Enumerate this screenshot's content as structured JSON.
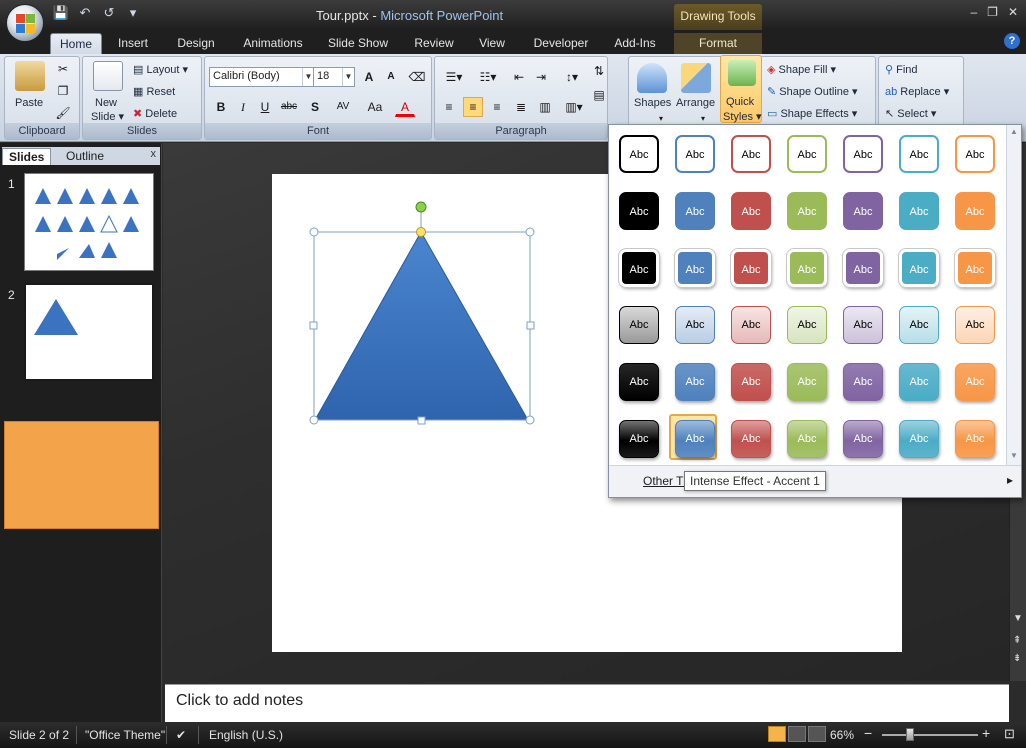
{
  "window": {
    "title_file": "Tour.pptx",
    "title_sep": " - ",
    "title_app": "Microsoft PowerPoint",
    "context_tab_group": "Drawing Tools",
    "controls": [
      "–",
      "❐",
      "✕"
    ],
    "help": "?"
  },
  "quick_access": {
    "save": "💾",
    "undo": "↶",
    "redo": "↺",
    "more": "▾"
  },
  "tabs": [
    "Home",
    "Insert",
    "Design",
    "Animations",
    "Slide Show",
    "Review",
    "View",
    "Developer",
    "Add-Ins",
    "Format"
  ],
  "ribbon": {
    "clipboard": {
      "group": "Clipboard",
      "paste": "Paste"
    },
    "slides": {
      "group": "Slides",
      "new_slide": "New",
      "new_slide2": "Slide ▾",
      "layout": "Layout ▾",
      "reset": "Reset",
      "delete": "Delete"
    },
    "font": {
      "group": "Font",
      "family": "Calibri (Body)",
      "size": "18",
      "grow": "A",
      "shrink": "A",
      "bold": "B",
      "italic": "I",
      "underline": "U",
      "strike": "abc",
      "shadow": "S",
      "spacing": "AV",
      "case": "Aa",
      "color": "A"
    },
    "paragraph": {
      "group": "Paragraph"
    },
    "drawing": {
      "shapes": "Shapes",
      "arrange": "Arrange",
      "quick_styles": "Quick",
      "quick_styles2": "Styles ▾",
      "shape_fill": "Shape Fill ▾",
      "shape_outline": "Shape Outline ▾",
      "shape_effects": "Shape Effects ▾"
    },
    "editing": {
      "find": "Find",
      "replace": "Replace ▾",
      "select": "Select ▾"
    }
  },
  "left_panel": {
    "tab_slides": "Slides",
    "tab_outline": "Outline",
    "close": "x",
    "slide_numbers": [
      "1",
      "2"
    ]
  },
  "notes": {
    "placeholder": "Click to add notes"
  },
  "status": {
    "slide": "Slide 2 of 2",
    "theme": "\"Office Theme\"",
    "language": "English (U.S.)",
    "zoom": "66%",
    "zoom_out": "−",
    "zoom_in": "+"
  },
  "gallery": {
    "swatch_label": "Abc",
    "colors": [
      "#000000",
      "#4f81bd",
      "#c0504d",
      "#9bbb59",
      "#8064a2",
      "#4bacc6",
      "#f79646"
    ],
    "rows": [
      {
        "style": "outline",
        "text": [
          "#000000",
          "#000000",
          "#000000",
          "#000000",
          "#000000",
          "#000000",
          "#000000"
        ]
      },
      {
        "style": "solid",
        "text": [
          "#ffffff",
          "#ffffff",
          "#ffffff",
          "#ffffff",
          "#ffffff",
          "#ffffff",
          "#ffffff"
        ]
      },
      {
        "style": "solid-white-border",
        "text": [
          "#ffffff",
          "#ffffff",
          "#ffffff",
          "#ffffff",
          "#ffffff",
          "#ffffff",
          "#ffffff"
        ]
      },
      {
        "style": "light",
        "text": [
          "#000000",
          "#000000",
          "#000000",
          "#000000",
          "#000000",
          "#000000",
          "#000000"
        ]
      },
      {
        "style": "gradient",
        "text": [
          "#ffffff",
          "#ffffff",
          "#ffffff",
          "#ffffff",
          "#ffffff",
          "#ffffff",
          "#ffffff"
        ]
      },
      {
        "style": "intense",
        "text": [
          "#ffffff",
          "#ffffff",
          "#ffffff",
          "#ffffff",
          "#ffffff",
          "#ffffff",
          "#ffffff"
        ]
      }
    ],
    "highlighted": {
      "row": 5,
      "col": 1
    },
    "footer": "Other Th",
    "tooltip": "Intense Effect - Accent 1",
    "footer_arrow": "▸"
  },
  "slide_shape": {
    "type": "triangle",
    "fill": "#3c73c0"
  }
}
